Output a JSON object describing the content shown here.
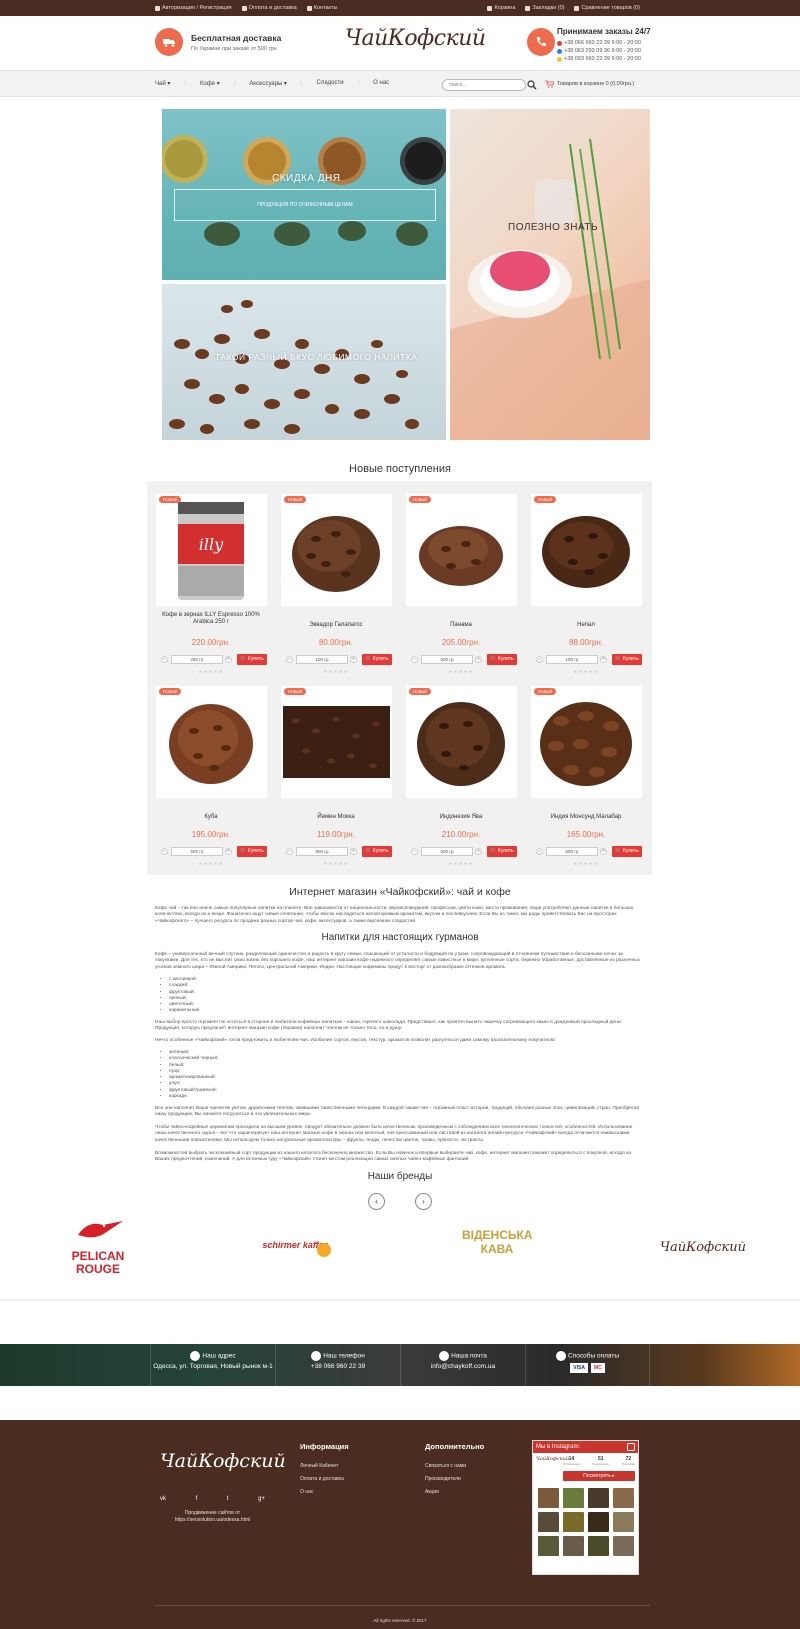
{
  "topbar": {
    "auth": "Авторизация / Регистрация",
    "payment": "Оплата и доставка",
    "contacts": "Контакты",
    "cart": "Корзина",
    "bookmarks": "Закладки (0)",
    "compare": "Сравнение товаров (0)"
  },
  "header": {
    "delivery_title": "Бесплатная доставка",
    "delivery_sub": "По Украине при заказе от 500 грн.",
    "logo": "ЧайКофский",
    "phones_title": "Принимаем заказы 24/7",
    "phones": [
      "+38 066 960 22 39  9:00 - 20:00",
      "+38 063 293 09 36  9:00 - 20:00",
      "+38 093 960 22 39  9:00 - 20:00"
    ]
  },
  "nav": {
    "items": [
      "Чай ▾",
      "Кофе ▾",
      "Аксессуары ▾",
      "Сладости",
      "О нас"
    ],
    "search_placeholder": "поиск...",
    "cart": "Товаров в корзине 0 (0.00грн.)"
  },
  "hero": {
    "deal": "СКИДКА ДНЯ",
    "deal_sub": "ПРОДУКЦИЯ ПО СНИЖЕННЫМ ЦЕНАМ",
    "useful": "ПОЛЕЗНО ЗНАТЬ",
    "taste": "ТАКОЙ РАЗНЫЙ ВКУС ЛЮБИМОГО НАПИТКА"
  },
  "new_arrivals_title": "Новые поступления",
  "products": [
    {
      "badge": "Новый",
      "name": "Кофе в зернах ILLY Espresso 100% Arabica 250 г",
      "price": "220.00грн.",
      "qty": "250 гр"
    },
    {
      "badge": "Новый",
      "name": "Эквадор Галапагос",
      "price": "80.00грн.",
      "qty": "100 гр"
    },
    {
      "badge": "Новый",
      "name": "Панама",
      "price": "205.00грн.",
      "qty": "500 гр"
    },
    {
      "badge": "Новый",
      "name": "Непал",
      "price": "88.00грн.",
      "qty": "100 гр"
    },
    {
      "badge": "Новый",
      "name": "Куба",
      "price": "195.00грн.",
      "qty": "500 гр"
    },
    {
      "badge": "Новый",
      "name": "Йемен Мокка",
      "price": "119.00грн.",
      "qty": "500 гр"
    },
    {
      "badge": "Новый",
      "name": "Индонезия Ява",
      "price": "210.00грн.",
      "qty": "500 гр"
    },
    {
      "badge": "Новый",
      "name": "Индия Монсунд Малабар",
      "price": "165.00грн.",
      "qty": "500 гр"
    }
  ],
  "buy_label": "Купить",
  "stars": "★★★★★",
  "about": {
    "title": "Интернет магазин «Чайкофский»: чай и кофе",
    "intro": "Кофе чай – так или иначе самые популярные напитки на планете. Вне зависимости от национальности, вероисповедания, профессии, цвета кожи, места проживания, люди употребляют данные напитки в больших количествах, всегда их и везде. Фанатично ищут новые сочетания, чтобы вволю насладиться неповторимым ароматом, вкусом и послевкусием. Если Вы из таких, мы рады приветствовать Вас на просторах «Чайкофского» – лучшего ресурса по продаже разных сортов чая, кофе, аксессуаров, а также вкусняшек сладостей.",
    "gourmet_title": "Напитки для настоящих гурманов",
    "p1": "Кофе – универсальный вечный спутник, разделяющий одиночество и радость в кругу семьи, спасающий от усталости и бодрящий по утрам, сопровождающий в отчаянном путешествии и бессонными ночах за покупками. Для тех, кто не мыслит свою жизнь без хорошего кофе, наш интернет магазин кофе надежного определяет самые известные в мире, купленные сорта, бережно обработанные, доставленные из различных уголков земного шара – Южной Америки, Пятого, Центральной Америки, Индии. Настоящие кофеманы придут в восторг от разнообразия оттенков аромата:",
    "list1": [
      "с кислинкой;",
      "сладкий;",
      "фруктовый;",
      "пряный;",
      "цветочный;",
      "карамельный."
    ],
    "p2": "Наш выбор просто огромен! Не остаться в стороне и любители кофейных напитков – какао, горячего шоколада. Представьте, как приятно выпить чашечку согревающего какао в дождливый прохладный день! Продукция, которую предлагает интернет магазин кофе (Украина) наполнит теплом не только тело, но и душу.",
    "p3": "Нечто особенное «Чайкофский» готов предложить и любителям чая. Изобилие сортов, вкусов, текстур, ароматов позволит разгуляться даже самому взыскательному покупателю:",
    "list2": [
      "зеленый;",
      "классический черный;",
      "белый;",
      "пуэр;",
      "ароматизированный;",
      "улун;",
      "фруктовый/травяной;",
      "каркаде."
    ],
    "p4": "Все они наполнят Ваше чаепитие уютом, дружескими тёплом, ожившими таинственными легендами. В каждой чашке чая – огромный пласт истории, традиций, обычаев разных эпох, цивилизаций, стран. Приобретая нашу продукцию, Вы сможете погрузиться в эти увлекательные миры.",
    "p5": "Чтобы чайно-кофейные церемонии проходили на высшем уровне, продукт обязательно должен быть качественным, произведенным с соблюдением всех технологических тонкостей, особенностей. Использование лишь качественного сырья – вот что характеризует наш интернет магазин кофе в зернах или молотый, чая прессованный или листовой из каталога онлайн-ресурса «Чайкофский» всегда отличается наивысшими качественными показателями. Мы используем только натуральные ароматизаторы – фрукты, ягоды, лепестки цветов, травы, пряности, экстракты.",
    "p6": "Возможностей выбрать эксклюзивный сорт продукции из нашего каталога бесконечно множество. Если Вы новичок и впервые выбираете чай, кофе, интернет магазин поможет определиться с покупкой, исходя из Ваших предпочтений, пожеланий. А для истинных гуру «Чайкофский» станет местом реализации самых смелых чайно-кофейных фантазий."
  },
  "brands": {
    "title": "Наши бренды",
    "items": [
      "PELICAN ROUGE",
      "schirmer kaffee",
      "ВІДЕНСЬКА КАВА",
      "ЧайКофский"
    ]
  },
  "contact_strip": {
    "address_title": "Наш адрес",
    "address": "Одесса, ул. Торговая, Новый рынок м-1",
    "phone_title": "Наш телефон",
    "phone": "+38 066 960 22 39",
    "email_title": "Наша почта",
    "email": "info@chaykoff.com.ua",
    "payment_title": "Способы оплаты",
    "payment_cards": [
      "VISA",
      "MC"
    ]
  },
  "footer": {
    "logo": "ЧайКофский",
    "socials": [
      "vk",
      "f",
      "t",
      "g+"
    ],
    "promo": "Продвижение сайтов от https://seosolution.ua/odessa.html",
    "info_title": "Информация",
    "info_links": [
      "Личный Кабинет",
      "Оплата и доставка",
      "О нас"
    ],
    "extra_title": "Дополнительно",
    "extra_links": [
      "Связаться с нами",
      "Производители",
      "Акции"
    ],
    "copyright": "All rights reserved. © 2017"
  },
  "instagram": {
    "title": "Мы в Instagram:",
    "logo": "ЧайКофский",
    "posts": "14",
    "posts_label": "Публикации",
    "followers": "51",
    "followers_label": "Подписчики",
    "following": "72",
    "following_label": "Подписки",
    "follow_button": "Посмотреть ▸"
  },
  "colors": {
    "brand_brown": "#4a2c20",
    "accent": "#ee6c4d",
    "buy_red": "#e53935"
  }
}
